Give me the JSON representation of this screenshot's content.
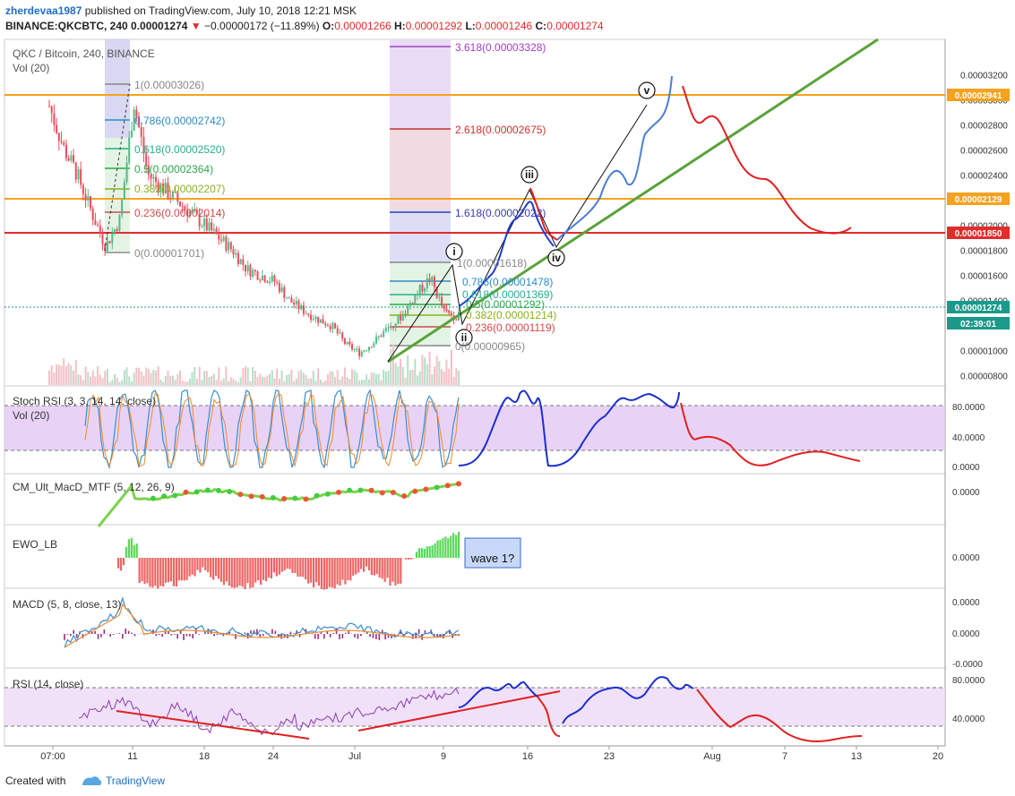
{
  "header": {
    "username": "zherdevaa1987",
    "published_text": "published on TradingView.com, July 10, 2018 12:21 MSK",
    "symbol": "BINANCE:QKCBTC, 240",
    "last": "0.00001274",
    "change": "−0.00000172 (−11.89%)",
    "o_label": "O:",
    "o": "0.00001266",
    "h_label": "H:",
    "h": "0.00001292",
    "l_label": "L:",
    "l": "0.00001246",
    "c_label": "C:",
    "c": "0.00001274"
  },
  "main_pane": {
    "title": "QKC / Bitcoin, 240, BINANCE",
    "vol_label": "Vol (20)",
    "price_ticks": [
      "0.00003200",
      "0.00003000",
      "0.00002800",
      "0.00002600",
      "0.00002400",
      "0.00002200",
      "0.00002000",
      "0.00001800",
      "0.00001600",
      "0.00001400",
      "0.00001200",
      "0.00001000",
      "0.00000800"
    ],
    "badges": [
      {
        "value": "0.00002941",
        "color": "#f5a21d"
      },
      {
        "value": "0.00002129",
        "color": "#f5a21d"
      },
      {
        "value": "0.00001850",
        "color": "#e32b2b"
      },
      {
        "value": "0.00001274",
        "color": "#1a9a8a"
      },
      {
        "value": "02:39:01",
        "color": "#1a9a8a"
      }
    ],
    "fib_left": [
      {
        "label": "1(0.00003026)",
        "color": "#888888"
      },
      {
        "label": "0.786(0.00002742)",
        "color": "#2a8cc8"
      },
      {
        "label": "0.618(0.00002520)",
        "color": "#23b08c"
      },
      {
        "label": "0.5(0.00002364)",
        "color": "#2aa84a"
      },
      {
        "label": "0.382(0.00002207)",
        "color": "#8ab21a"
      },
      {
        "label": "0.236(0.00002014)",
        "color": "#d24a4a"
      },
      {
        "label": "0(0.00001701)",
        "color": "#888888"
      }
    ],
    "fib_right": [
      {
        "label": "3.618(0.00003328)",
        "color": "#a040c0"
      },
      {
        "label": "2.618(0.00002675)",
        "color": "#c83232"
      },
      {
        "label": "1.618(0.00002022)",
        "color": "#3a3ab0"
      },
      {
        "label": "1(0.00001618)",
        "color": "#888888"
      },
      {
        "label": "0.786(0.00001478)",
        "color": "#2a8cc8"
      },
      {
        "label": "0.618(0.00001369)",
        "color": "#23b08c"
      },
      {
        "label": "0.5(0.00001292)",
        "color": "#2aa84a"
      },
      {
        "label": "0.382(0.00001214)",
        "color": "#8ab21a"
      },
      {
        "label": "0.236(0.00001119)",
        "color": "#d24a4a"
      },
      {
        "label": "0(0.00000965)",
        "color": "#888888"
      }
    ],
    "wave_labels": [
      "i",
      "ii",
      "iii",
      "iv",
      "v"
    ]
  },
  "panes": {
    "stoch": {
      "title": "Stoch RSI (3, 3, 14, 14, close)",
      "vol_label": "Vol (20)",
      "ticks": [
        "80.0000",
        "40.0000",
        "0.0000"
      ]
    },
    "cm": {
      "title": "CM_Ult_MacD_MTF (5, 12, 26, 9)",
      "ticks": [
        "0.0000"
      ]
    },
    "ewo": {
      "title": "EWO_LB",
      "ticks": [
        "0.0000"
      ],
      "callout": "wave 1?"
    },
    "macd": {
      "title": "MACD (5, 8, close, 13)",
      "ticks": [
        "0.0000",
        "0.0000",
        "-0.0000"
      ]
    },
    "rsi": {
      "title": "RSI (14, close)",
      "ticks": [
        "80.0000",
        "40.0000"
      ]
    }
  },
  "time_axis": [
    "07:00",
    "11",
    "18",
    "24",
    "Jul",
    "9",
    "16",
    "23",
    "Aug",
    "7",
    "13",
    "20"
  ],
  "footer": {
    "created_with": "Created with",
    "brand": "TradingView"
  },
  "colors": {
    "up": "#53b987",
    "down": "#eb4d5c",
    "accent": "#1e6ec8"
  },
  "chart_data": {
    "type": "candlestick",
    "symbol": "QKC / Bitcoin, 240, BINANCE",
    "x": [
      "07:00",
      "11",
      "18",
      "24",
      "Jul",
      "9",
      "16",
      "23",
      "Aug",
      "7",
      "13",
      "20"
    ],
    "price_axis_range": [
      7.2e-06,
      3.35e-05
    ],
    "horizontal_levels": [
      2.941e-05,
      2.129e-05,
      1.85e-05
    ],
    "last_price": 1.274e-05,
    "sample_closes": [
      2.95e-05,
      2.62e-05,
      2.4e-05,
      2.1e-05,
      1.83e-05,
      2.05e-05,
      2.98e-05,
      2.4e-05,
      2.3e-05,
      2.2e-05,
      2.1e-05,
      2e-05,
      1.9e-05,
      1.8e-05,
      1.65e-05,
      1.6e-05,
      1.55e-05,
      1.4e-05,
      1.32e-05,
      1.25e-05,
      1.2e-05,
      1.05e-05,
      9.8e-06,
      1.07e-05,
      1.18e-05,
      1.28e-05,
      1.45e-05,
      1.58e-05,
      1.3e-05,
      1.274e-05
    ],
    "projection_blue": [
      [
        1.274e-05
      ],
      [
        1.35e-05
      ],
      [
        1.85e-05
      ],
      [
        2.15e-05
      ],
      [
        1.85e-05
      ],
      [
        1.75e-05
      ],
      [
        2.1e-05
      ],
      [
        2.35e-05
      ],
      [
        2.8e-05
      ],
      [
        3e-05
      ]
    ],
    "projection_red": [
      [
        3e-05
      ],
      [
        2.75e-05
      ],
      [
        2.8e-05
      ],
      [
        2.4e-05
      ],
      [
        2.15e-05
      ],
      [
        1.95e-05
      ],
      [
        1.85e-05
      ],
      [
        1.86e-05
      ]
    ]
  }
}
